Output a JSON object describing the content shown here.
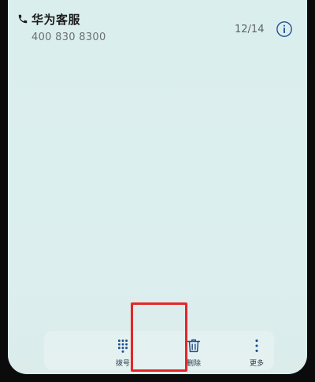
{
  "header": {
    "contact_name": "华为客服",
    "contact_number": "400 830 8300",
    "counter": "12/14"
  },
  "icons": {
    "phone": "phone-icon",
    "info": "info-icon",
    "dialpad": "dialpad-icon",
    "delete": "trash-icon",
    "more": "more-icon"
  },
  "toolbar": {
    "dial_label": "拨号",
    "delete_label": "删除",
    "more_label": "更多"
  },
  "colors": {
    "accent": "#1f4e8e",
    "highlight": "#e52626"
  }
}
